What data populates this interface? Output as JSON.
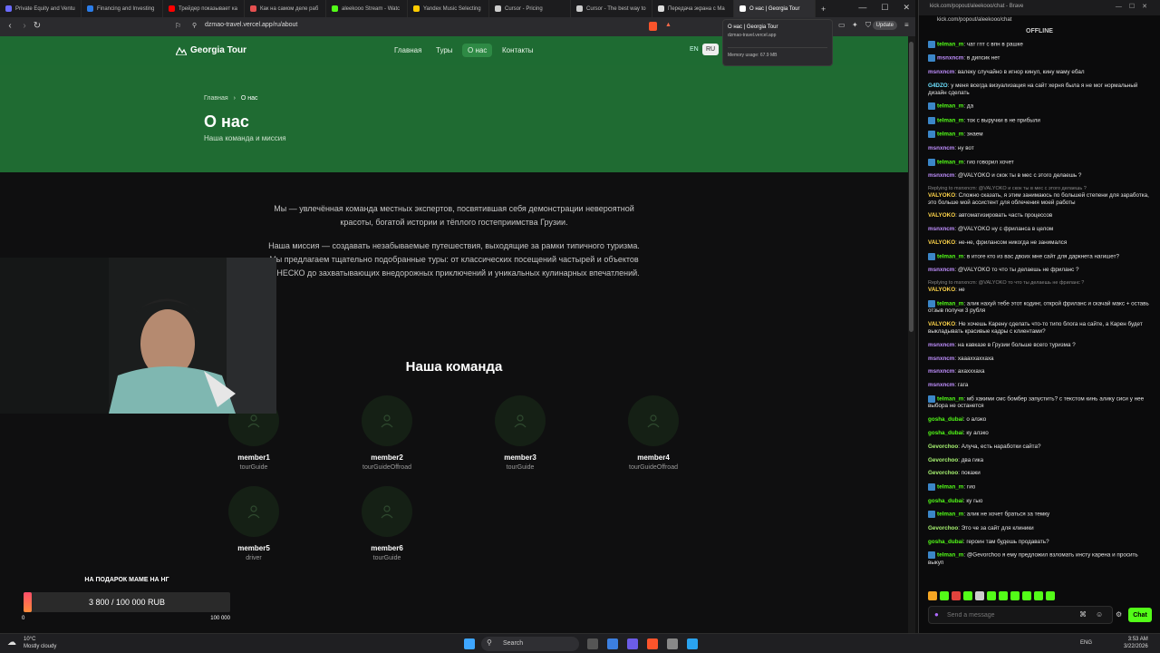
{
  "browser": {
    "tabs": [
      {
        "label": "Private Equity and Ventu",
        "color": "#6b6bff"
      },
      {
        "label": "Financing and Investing",
        "color": "#2b7de9"
      },
      {
        "label": "Трейдер показывает ка",
        "color": "#ff0000"
      },
      {
        "label": "Как на самом деле раб",
        "color": "#e55050"
      },
      {
        "label": "aleekooo Stream - Watc",
        "color": "#53fc18"
      },
      {
        "label": "Yandex Music Selecting",
        "color": "#ffcc00"
      },
      {
        "label": "Cursor - Pricing",
        "color": "#cccccc"
      },
      {
        "label": "Cursor - The best way to",
        "color": "#cccccc"
      },
      {
        "label": "Передача экрана с Ma",
        "color": "#dddddd"
      },
      {
        "label": "О нас | Georgia Tour",
        "color": "#ffffff"
      }
    ],
    "url": "dzmao-travel.vercel.app/ru/about",
    "update_label": "Update",
    "tooltip": {
      "title": "О нас | Georgia Tour",
      "host": "dzmao-travel.vercel.app",
      "memory": "Memory usage: 67.9 MB"
    }
  },
  "site": {
    "logo": "Georgia Tour",
    "nav": [
      "Главная",
      "Туры",
      "О нас",
      "Контакты"
    ],
    "lang_en": "EN",
    "lang_ru": "RU",
    "breadcrumb_home": "Главная",
    "breadcrumb_sep": "›",
    "breadcrumb_current": "О нас",
    "title": "О нас",
    "subtitle": "Наша команда и миссия",
    "para1": "Мы — увлечённая команда местных экспертов, посвятившая себя демонстрации невероятной красоты, богатой истории и тёплого гостеприимства Грузии.",
    "para2": "Наша миссия — создавать незабываемые путешествия, выходящие за рамки типичного туризма. Мы предлагаем тщательно подобранные туры: от классических посещений частырей и объектов ЮНЕСКО до захватывающих внедорожных приключений и уникальных кулинарных впечатлений.",
    "team_title": "Наша команда",
    "members": [
      {
        "name": "member1",
        "role": "tourGuide"
      },
      {
        "name": "member2",
        "role": "tourGuideOffroad"
      },
      {
        "name": "member3",
        "role": "tourGuide"
      },
      {
        "name": "member4",
        "role": "tourGuideOffroad"
      },
      {
        "name": "member5",
        "role": "driver"
      },
      {
        "name": "member6",
        "role": "tourGuide"
      }
    ]
  },
  "donation": {
    "title": "НА ПОДАРОК МАМЕ НА НГ",
    "amount": "3 800 / 100 000 RUB",
    "min": "0",
    "max": "100 000",
    "progress": 0.038
  },
  "chat": {
    "window_title": "kick.com/popout/aleekooo/chat - Brave",
    "url": "kick.com/popout/aleekooo/chat",
    "status": "OFFLINE",
    "input_placeholder": "Send a message",
    "send_label": "Chat",
    "messages": [
      {
        "user": "telman_m",
        "color": "#53fc18",
        "badge": true,
        "text": "чат гпт с впн в рашке"
      },
      {
        "user": "msnxncm",
        "color": "#c08fff",
        "badge": true,
        "text": "в дипсик нет"
      },
      {
        "user": "msnxncm",
        "color": "#c08fff",
        "badge": false,
        "text": "валеку случайно в игнор кинул, кину маму ебал"
      },
      {
        "user": "G4DZO",
        "color": "#6de0ff",
        "badge": false,
        "text": "у меня всегда визуализация на сайт херня была я не мог нормальный дизайн сделать"
      },
      {
        "user": "telman_m",
        "color": "#53fc18",
        "badge": true,
        "text": "да"
      },
      {
        "user": "telman_m",
        "color": "#53fc18",
        "badge": true,
        "text": "ток с выручки в не прибыли"
      },
      {
        "user": "telman_m",
        "color": "#53fc18",
        "badge": true,
        "text": "знаем"
      },
      {
        "user": "msnxncm",
        "color": "#c08fff",
        "badge": false,
        "text": "ну вот"
      },
      {
        "user": "telman_m",
        "color": "#53fc18",
        "badge": true,
        "text": "гио говорил хочет"
      },
      {
        "user": "msnxncm",
        "color": "#c08fff",
        "badge": false,
        "text": "@VALYOKO и скок ты в мес с этого делаешь ?"
      },
      {
        "reply": "Replying to msnxncm: @VALYOKO и скок ты в мес с этого делаешь ?",
        "user": "VALYOKO",
        "color": "#ffd54a",
        "badge": false,
        "text": "Сложно сказать, я этим занимаюсь по большей степени для заработка, это больше мой ассистент для облечения моей работы"
      },
      {
        "user": "VALYOKO",
        "color": "#ffd54a",
        "badge": false,
        "text": "автоматизировать часть процессов"
      },
      {
        "user": "msnxncm",
        "color": "#c08fff",
        "badge": false,
        "text": "@VALYOKO ну с фриланса в целом"
      },
      {
        "user": "VALYOKO",
        "color": "#ffd54a",
        "badge": false,
        "text": "не-не, фрилансом никогда не занимался"
      },
      {
        "user": "telman_m",
        "color": "#53fc18",
        "badge": true,
        "text": "в итоге кто из вас двоих мне сайт для даркнета нагишет?"
      },
      {
        "user": "msnxncm",
        "color": "#c08fff",
        "badge": false,
        "text": "@VALYOKO то что ты делаешь не фриланс ?"
      },
      {
        "reply": "Replying to msnxncm: @VALYOKO то что ты делаешь не фриланс ?",
        "user": "VALYOKO",
        "color": "#ffd54a",
        "badge": false,
        "text": "не"
      },
      {
        "user": "telman_m",
        "color": "#53fc18",
        "badge": true,
        "text": "алик нахуй тебе этот кодинг, открой фриланс и скачай макс + оставь отзыв получи 3 рубля"
      },
      {
        "user": "VALYOKO",
        "color": "#ffd54a",
        "badge": false,
        "text": "Не хочешь Карену сделать что-то типо блога на сайте, а Карен будет выкладывать красивые кадры с клиентами?"
      },
      {
        "user": "msnxncm",
        "color": "#c08fff",
        "badge": false,
        "text": "на кавказе в Грузии больше всего туризма ?"
      },
      {
        "user": "msnxncm",
        "color": "#c08fff",
        "badge": false,
        "text": "хаааххаххаха"
      },
      {
        "user": "msnxncm",
        "color": "#c08fff",
        "badge": false,
        "text": "ахахххаха"
      },
      {
        "user": "msnxncm",
        "color": "#c08fff",
        "badge": false,
        "text": "гага"
      },
      {
        "user": "telman_m",
        "color": "#53fc18",
        "badge": true,
        "text": "мб хакими смс бомбер запустить? с текстом кинь алику сиси у нее выбора не останется"
      },
      {
        "user": "gosha_dubai",
        "color": "#53fc18",
        "badge": false,
        "text": "о алэко"
      },
      {
        "user": "gosha_dubai",
        "color": "#53fc18",
        "badge": false,
        "text": "ку алэко"
      },
      {
        "user": "Gevorchoo",
        "color": "#a6f070",
        "badge": false,
        "text": "Алуча, есть наработки сайта?"
      },
      {
        "user": "Gevorchoo",
        "color": "#a6f070",
        "badge": false,
        "text": "два гика"
      },
      {
        "user": "Gevorchoo",
        "color": "#a6f070",
        "badge": false,
        "text": "покажи"
      },
      {
        "user": "telman_m",
        "color": "#53fc18",
        "badge": true,
        "text": "гио"
      },
      {
        "user": "gosha_dubai",
        "color": "#53fc18",
        "badge": false,
        "text": "ку гыо"
      },
      {
        "user": "telman_m",
        "color": "#53fc18",
        "badge": true,
        "text": "алик не хочет браться за темку"
      },
      {
        "user": "Gevorchoo",
        "color": "#a6f070",
        "badge": false,
        "text": "Это че за сайт для клиники"
      },
      {
        "user": "gosha_dubai",
        "color": "#53fc18",
        "badge": false,
        "text": "героин там будешь продавать?"
      },
      {
        "user": "telman_m",
        "color": "#53fc18",
        "badge": true,
        "text": "@Gevorchoo я ему предложил взломать инсту карена и просить выкуп"
      }
    ]
  },
  "taskbar": {
    "weather_temp": "10°C",
    "weather_desc": "Mostly cloudy",
    "search": "Search",
    "lang": "ENG",
    "time": "3:53 AM",
    "date": "3/22/2026"
  }
}
